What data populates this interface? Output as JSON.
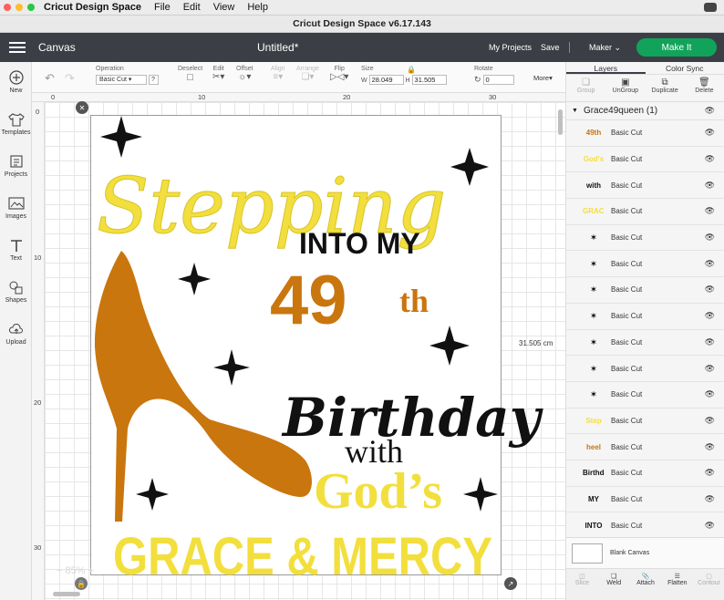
{
  "menubar": {
    "app": "Cricut Design Space",
    "menus": [
      "File",
      "Edit",
      "View",
      "Help"
    ]
  },
  "window": {
    "title": "Cricut Design Space  v6.17.143"
  },
  "header": {
    "canvas_label": "Canvas",
    "doc_title": "Untitled*",
    "my_projects": "My Projects",
    "save": "Save",
    "machine": "Maker",
    "make_it": "Make It"
  },
  "sidebar": {
    "items": [
      {
        "label": "New",
        "icon": "plus-circle-icon"
      },
      {
        "label": "Templates",
        "icon": "shirt-icon"
      },
      {
        "label": "Projects",
        "icon": "projects-icon"
      },
      {
        "label": "Images",
        "icon": "image-icon"
      },
      {
        "label": "Text",
        "icon": "text-icon"
      },
      {
        "label": "Shapes",
        "icon": "shapes-icon"
      },
      {
        "label": "Upload",
        "icon": "cloud-upload-icon"
      }
    ]
  },
  "toolbar": {
    "operation_label": "Operation",
    "operation_value": "Basic Cut",
    "help": "?",
    "deselect": "Deselect",
    "edit": "Edit",
    "offset": "Offset",
    "align": "Align",
    "arrange": "Arrange",
    "flip": "Flip",
    "size": "Size",
    "w_label": "W",
    "w_value": "28.049",
    "h_label": "H",
    "h_value": "31.505",
    "rotate": "Rotate",
    "rotate_value": "0",
    "more": "More"
  },
  "rulers": {
    "top": [
      "0",
      "10",
      "20",
      "30"
    ],
    "left": [
      "0",
      "10",
      "20",
      "30"
    ]
  },
  "canvas": {
    "dimension": "31.505 cm",
    "zoom": "85%"
  },
  "design": {
    "stepping": "Stepping",
    "into_my": "INTO MY",
    "number": "49",
    "suffix": "th",
    "birthday": "Birthday",
    "with": "with",
    "gods": "God’s",
    "grace": "GRACE & MERCY"
  },
  "colors": {
    "yellow": "#f2df3d",
    "orange": "#c9760e",
    "black": "#111111",
    "green": "#12a35a",
    "header": "#3b3f45"
  },
  "panel": {
    "tabs": [
      "Layers",
      "Color Sync"
    ],
    "actions": [
      "Group",
      "UnGroup",
      "Duplicate",
      "Delete"
    ],
    "group_name": "Grace49queen (1)",
    "layers": [
      {
        "thumb": "49th",
        "label": "Basic Cut"
      },
      {
        "thumb": "God's",
        "label": "Basic Cut"
      },
      {
        "thumb": "with",
        "label": "Basic Cut"
      },
      {
        "thumb": "GRACE",
        "label": "Basic Cut"
      },
      {
        "thumb": "✶",
        "label": "Basic Cut"
      },
      {
        "thumb": "✶",
        "label": "Basic Cut"
      },
      {
        "thumb": "✶",
        "label": "Basic Cut"
      },
      {
        "thumb": "✶",
        "label": "Basic Cut"
      },
      {
        "thumb": "✶",
        "label": "Basic Cut"
      },
      {
        "thumb": "✶",
        "label": "Basic Cut"
      },
      {
        "thumb": "✶",
        "label": "Basic Cut"
      },
      {
        "thumb": "Step",
        "label": "Basic Cut"
      },
      {
        "thumb": "heel",
        "label": "Basic Cut"
      },
      {
        "thumb": "Birthday",
        "label": "Basic Cut"
      },
      {
        "thumb": "MY",
        "label": "Basic Cut"
      },
      {
        "thumb": "INTO",
        "label": "Basic Cut"
      }
    ],
    "blank_canvas": "Blank Canvas",
    "bottom_actions": [
      "Slice",
      "Weld",
      "Attach",
      "Flatten",
      "Contour"
    ]
  }
}
